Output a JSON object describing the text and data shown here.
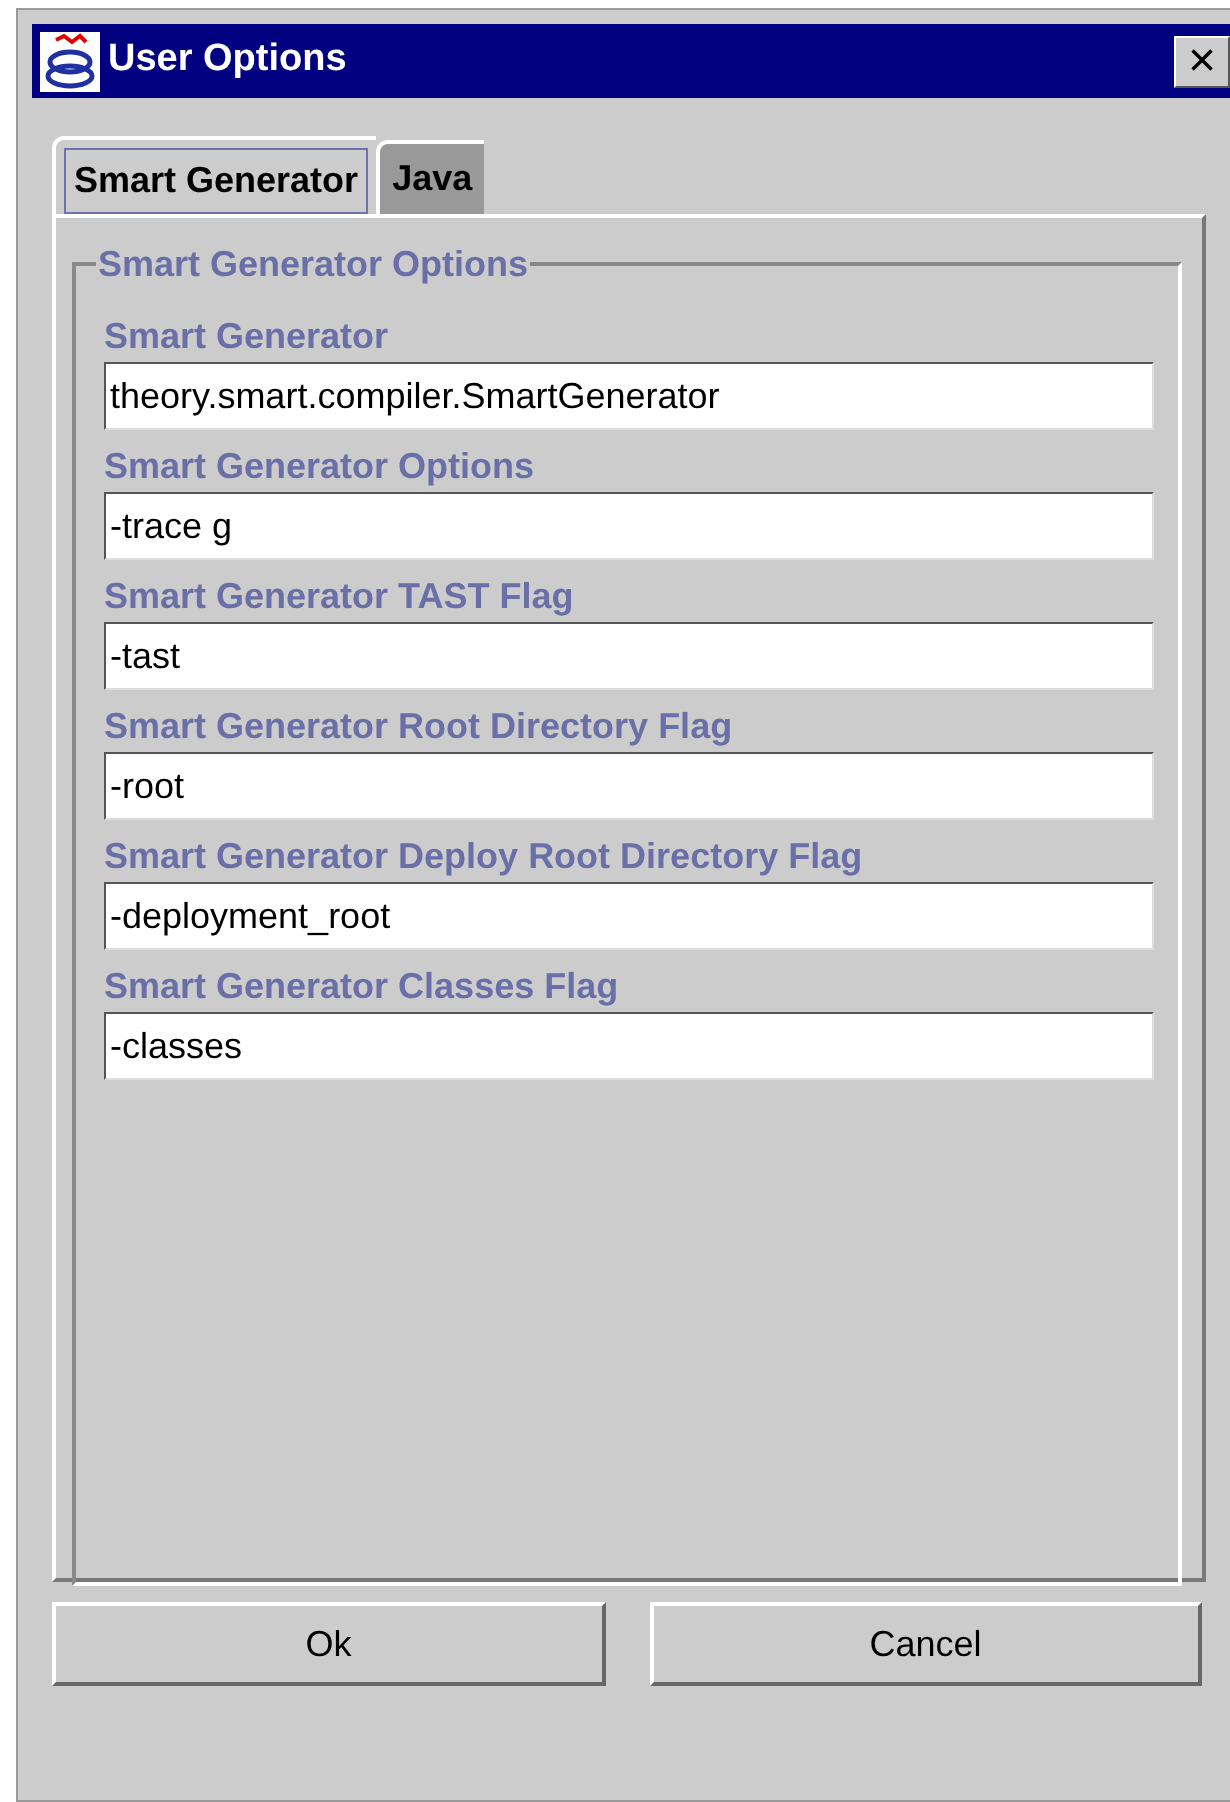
{
  "window": {
    "title": "User Options",
    "close": "×"
  },
  "tabs": [
    {
      "label": "Smart Generator",
      "selected": true
    },
    {
      "label": "Java",
      "selected": false
    }
  ],
  "group": {
    "title": "Smart Generator Options"
  },
  "fields": [
    {
      "label": "Smart Generator",
      "value": "theory.smart.compiler.SmartGenerator"
    },
    {
      "label": "Smart Generator Options",
      "value": "-trace g"
    },
    {
      "label": "Smart Generator TAST Flag",
      "value": "-tast"
    },
    {
      "label": "Smart Generator Root Directory Flag",
      "value": "-root"
    },
    {
      "label": "Smart Generator Deploy Root Directory Flag",
      "value": "-deployment_root"
    },
    {
      "label": "Smart Generator Classes Flag",
      "value": "-classes"
    }
  ],
  "buttons": [
    "Ok",
    "Cancel"
  ]
}
